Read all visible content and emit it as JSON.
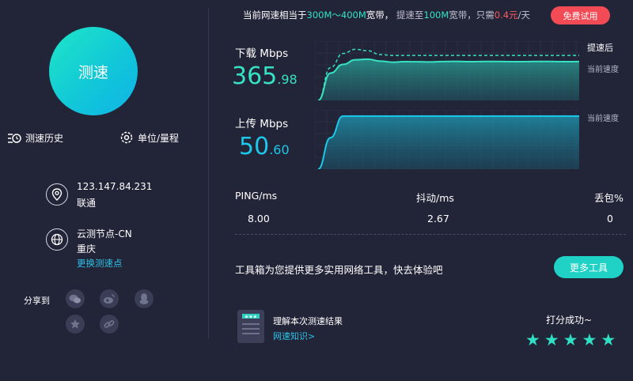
{
  "banner": {
    "prefix": "当前网速相当于",
    "range": "300M～400M",
    "suffix": "宽带，",
    "upgrade_prefix": "提速至",
    "upgrade_speed": "100M",
    "upgrade_suffix": "宽带，只需",
    "price": "0.4元",
    "per": "/天",
    "trial_button": "免费试用"
  },
  "left": {
    "speed_button": "测速",
    "history": "测速历史",
    "units": "单位/量程",
    "ip": "123.147.84.231",
    "isp": "联通",
    "node_name": "云测节点-CN",
    "node_city": "重庆",
    "change_node": "更换测速点",
    "share_label": "分享到"
  },
  "download": {
    "title": "下载 Mbps",
    "int": "365",
    "dec": ".98",
    "legend_after": "提速后",
    "legend_current": "当前速度"
  },
  "upload": {
    "title": "上传 Mbps",
    "int": "50",
    "dec": ".60",
    "legend_current": "当前速度"
  },
  "stats": {
    "ping_label": "PING/ms",
    "ping": "8.00",
    "jitter_label": "抖动/ms",
    "jitter": "2.67",
    "loss_label": "丢包%",
    "loss": "0"
  },
  "toolbox": {
    "text": "工具箱为您提供更多实用网络工具，快去体验吧",
    "button": "更多工具"
  },
  "knowledge": {
    "title": "理解本次测速结果",
    "link": "网速知识>"
  },
  "rating": {
    "text": "打分成功~",
    "stars": "★"
  },
  "colors": {
    "background": "#222438",
    "accent": "#1fd2c5",
    "download": "#37e2c4",
    "upload": "#1cc9ea",
    "trial": "#f34b55"
  },
  "chart_data": [
    {
      "type": "area",
      "title": "下载 Mbps",
      "series": [
        {
          "name": "当前速度",
          "values": [
            0,
            250,
            330,
            372,
            378,
            360,
            350,
            355,
            354,
            352,
            356,
            358,
            355,
            356,
            357,
            356,
            355,
            356,
            357,
            356,
            355,
            356
          ]
        },
        {
          "name": "提速后",
          "values": [
            0,
            300,
            430,
            468,
            455,
            420,
            412,
            412,
            412,
            412,
            412,
            412,
            412,
            412,
            412,
            412,
            412,
            412,
            412,
            412,
            412,
            412
          ]
        }
      ]
    },
    {
      "type": "area",
      "title": "上传 Mbps",
      "series": [
        {
          "name": "当前速度",
          "values": [
            0,
            30,
            50.6,
            50.6,
            50.6,
            50.6,
            50.6,
            50.6,
            50.6,
            50.6,
            50.6,
            50.6,
            50.6,
            50.6,
            50.6,
            50.6,
            50.6,
            50.6,
            50.6,
            50.6,
            50.6,
            50.6
          ]
        }
      ]
    }
  ]
}
